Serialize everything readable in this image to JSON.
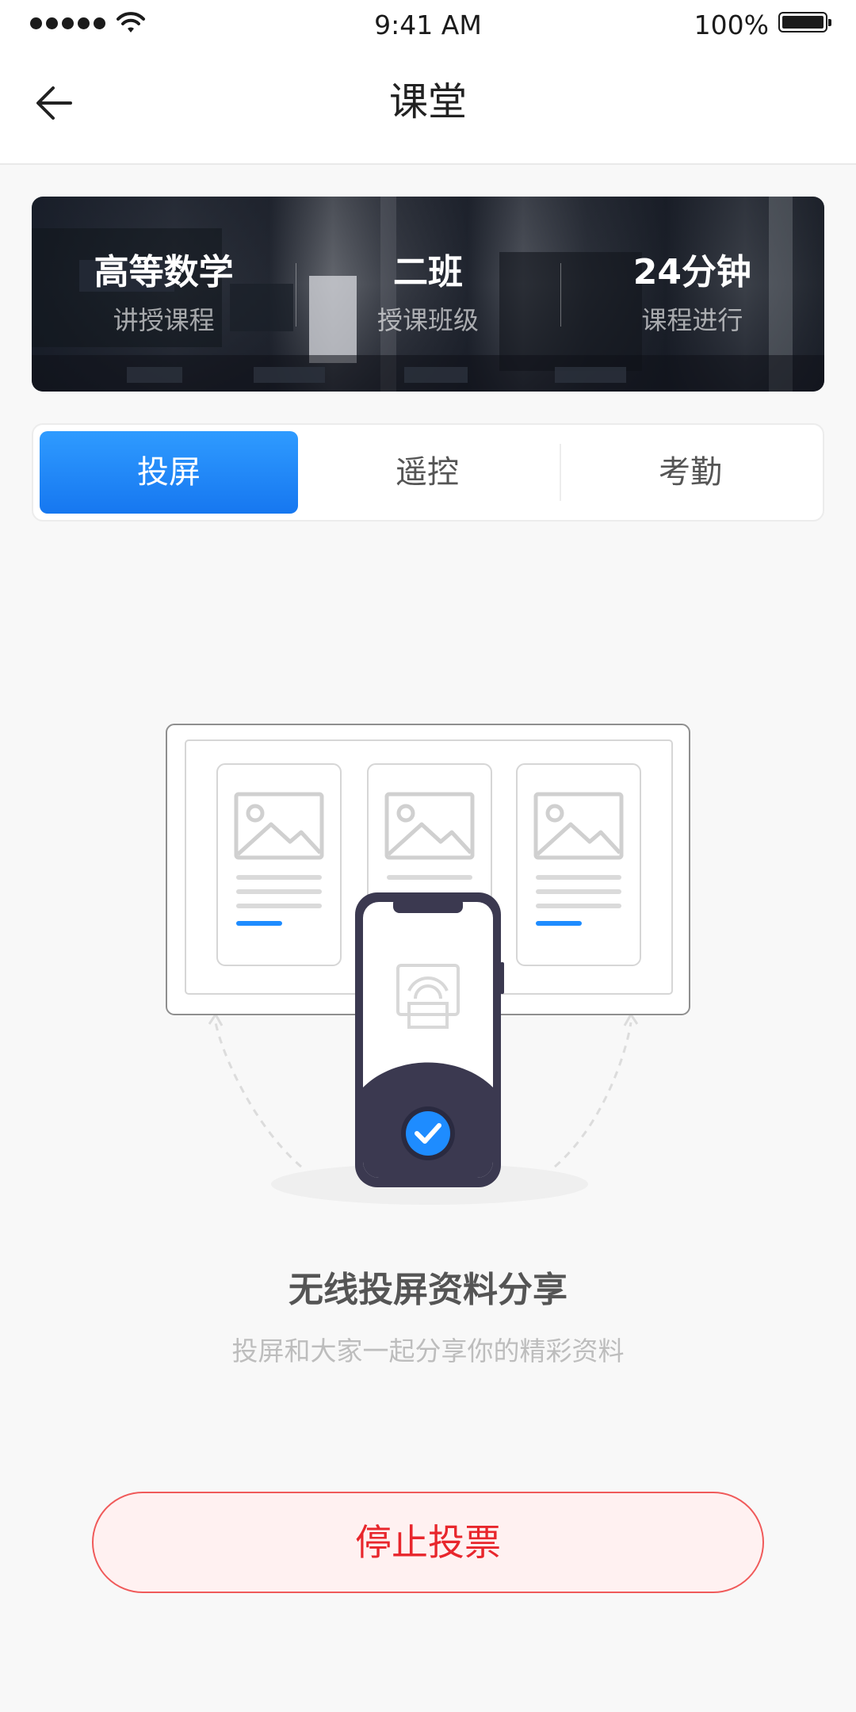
{
  "status_bar": {
    "time": "9:41 AM",
    "battery": "100%"
  },
  "nav": {
    "title": "课堂",
    "back_icon": "arrow-left-icon"
  },
  "banner": {
    "stats": [
      {
        "value": "高等数学",
        "label": "讲授课程"
      },
      {
        "value": "二班",
        "label": "授课班级"
      },
      {
        "value": "24分钟",
        "label": "课程进行"
      }
    ]
  },
  "tabs": [
    {
      "label": "投屏",
      "active": true
    },
    {
      "label": "遥控",
      "active": false
    },
    {
      "label": "考勤",
      "active": false
    }
  ],
  "illustration": {
    "icons": [
      "image-placeholder-icon",
      "cast-screen-icon",
      "check-circle-icon"
    ],
    "accent": "#1e8cff",
    "phone_color": "#3b3950"
  },
  "feature": {
    "title": "无线投屏资料分享",
    "subtitle": "投屏和大家一起分享你的精彩资料"
  },
  "stop_button": {
    "label": "停止投票"
  },
  "colors": {
    "primary": "#1e8cff",
    "danger": "#e8262c",
    "danger_bg": "#fff1f1",
    "background": "#f8f8f8"
  }
}
